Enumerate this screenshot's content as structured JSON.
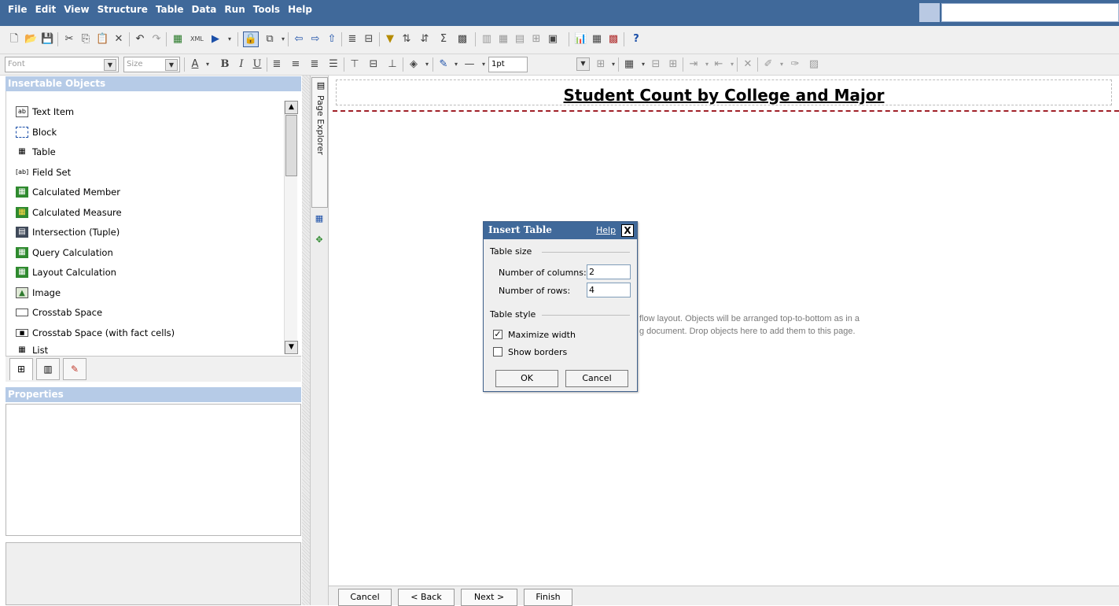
{
  "menu": [
    "File",
    "Edit",
    "View",
    "Structure",
    "Table",
    "Data",
    "Run",
    "Tools",
    "Help"
  ],
  "toolbar2": {
    "font_placeholder": "Font",
    "size_placeholder": "Size",
    "line_weight": "1pt"
  },
  "left_panel": {
    "insertable_title": "Insertable Objects",
    "properties_title": "Properties",
    "objects": [
      {
        "label": "Text Item",
        "icon": "text-item-icon"
      },
      {
        "label": "Block",
        "icon": "block-icon"
      },
      {
        "label": "Table",
        "icon": "table-icon"
      },
      {
        "label": "Field Set",
        "icon": "field-set-icon"
      },
      {
        "label": "Calculated Member",
        "icon": "calculated-member-icon"
      },
      {
        "label": "Calculated Measure",
        "icon": "calculated-measure-icon"
      },
      {
        "label": "Intersection (Tuple)",
        "icon": "intersection-icon"
      },
      {
        "label": "Query Calculation",
        "icon": "query-calculation-icon"
      },
      {
        "label": "Layout Calculation",
        "icon": "layout-calculation-icon"
      },
      {
        "label": "Image",
        "icon": "image-icon"
      },
      {
        "label": "Crosstab Space",
        "icon": "crosstab-space-icon"
      },
      {
        "label": "Crosstab Space (with fact cells)",
        "icon": "crosstab-space-fact-icon"
      },
      {
        "label": "List",
        "icon": "list-icon"
      }
    ]
  },
  "vertical_tab": {
    "label": "Page Explorer"
  },
  "canvas": {
    "title": "Student Count by College and Major",
    "hint_line1": "flow layout. Objects will be arranged top-to-bottom as in a",
    "hint_line2": "g document. Drop objects here to add them to this page."
  },
  "dialog": {
    "title": "Insert Table",
    "help": "Help",
    "close": "X",
    "size_group": "Table size",
    "columns_label": "Number of columns:",
    "columns_value": "2",
    "rows_label": "Number of rows:",
    "rows_value": "4",
    "style_group": "Table style",
    "maximize_label": "Maximize width",
    "maximize_checked": true,
    "borders_label": "Show borders",
    "borders_checked": false,
    "ok": "OK",
    "cancel": "Cancel"
  },
  "footer": {
    "cancel": "Cancel",
    "back": "< Back",
    "next": "Next >",
    "finish": "Finish"
  },
  "colors": {
    "menubar": "#40699a",
    "pane_header": "#b6cbe7",
    "header_line": "#a02028"
  }
}
